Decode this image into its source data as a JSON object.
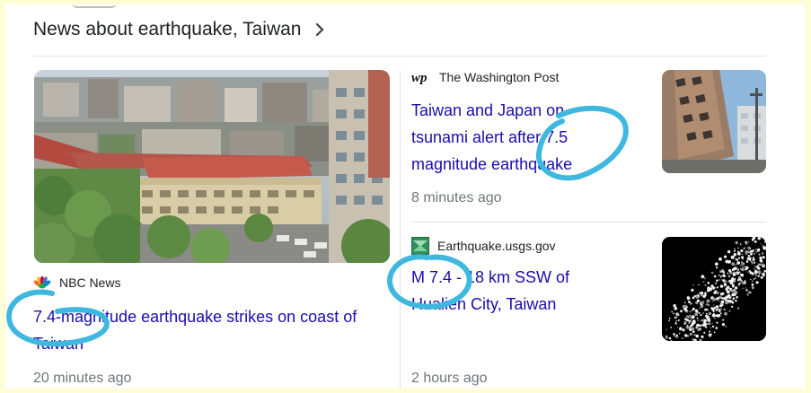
{
  "section": {
    "title": "News about earthquake, Taiwan"
  },
  "articles": [
    {
      "source": "NBC News",
      "headline": "7.4-magnitude earthquake strikes on coast of Taiwan",
      "age": "20 minutes ago",
      "image": "aerial-city-photo"
    },
    {
      "source": "The Washington Post",
      "source_logo": "wp",
      "headline": "Taiwan and Japan on tsunami alert after 7.5 magnitude earthquake",
      "age": "8 minutes ago",
      "image": "tilted-building-photo"
    },
    {
      "source": "Earthquake.usgs.gov",
      "headline": "M 7.4 - 18 km SSW of Hualien City, Taiwan",
      "age": "2 hours ago",
      "image": "seismicity-map"
    }
  ],
  "colors": {
    "link": "#1a0dab",
    "meta": "#70757a",
    "annotation": "#3fb8e0",
    "page_background": "#fdfdd6"
  }
}
